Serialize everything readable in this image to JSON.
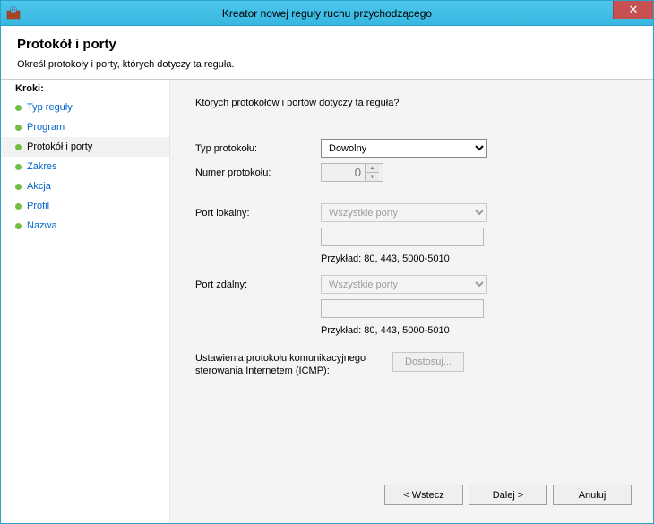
{
  "window": {
    "title": "Kreator nowej reguły ruchu przychodzącego"
  },
  "header": {
    "title": "Protokół i porty",
    "subtitle": "Określ protokoły i porty, których dotyczy ta reguła."
  },
  "steps": {
    "heading": "Kroki:",
    "items": [
      {
        "label": "Typ reguły",
        "current": false
      },
      {
        "label": "Program",
        "current": false
      },
      {
        "label": "Protokół i porty",
        "current": true
      },
      {
        "label": "Zakres",
        "current": false
      },
      {
        "label": "Akcja",
        "current": false
      },
      {
        "label": "Profil",
        "current": false
      },
      {
        "label": "Nazwa",
        "current": false
      }
    ]
  },
  "content": {
    "question": "Których protokołów i portów dotyczy ta reguła?",
    "protocol_type_label": "Typ protokołu:",
    "protocol_type_value": "Dowolny",
    "protocol_number_label": "Numer protokołu:",
    "protocol_number_value": "0",
    "local_port_label": "Port lokalny:",
    "local_port_value": "Wszystkie porty",
    "local_port_example": "Przykład: 80, 443, 5000-5010",
    "remote_port_label": "Port zdalny:",
    "remote_port_value": "Wszystkie porty",
    "remote_port_example": "Przykład: 80, 443, 5000-5010",
    "icmp_label": "Ustawienia protokołu komunikacyjnego sterowania Internetem (ICMP):",
    "customize_button": "Dostosuj..."
  },
  "footer": {
    "back": "< Wstecz",
    "next": "Dalej >",
    "cancel": "Anuluj"
  }
}
